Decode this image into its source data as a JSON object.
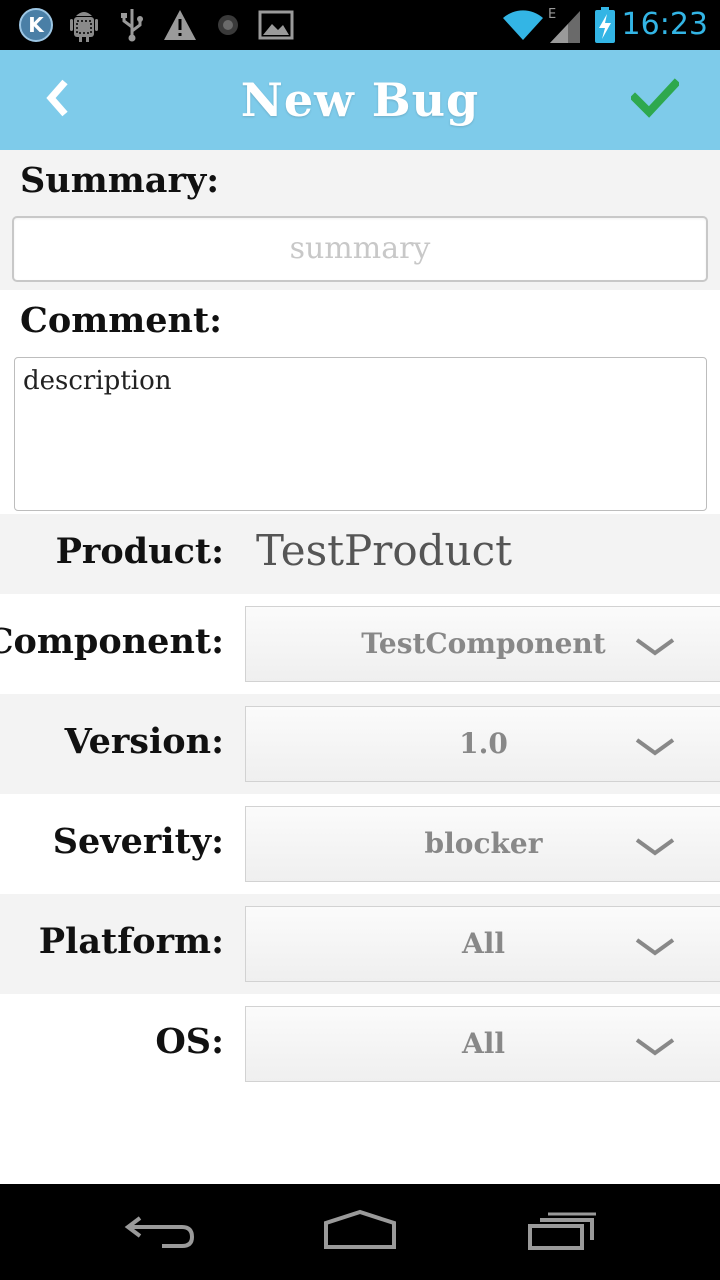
{
  "status_bar": {
    "time": "16:23",
    "icons": [
      "k-app-icon",
      "android-debug-icon",
      "usb-icon",
      "warning-icon",
      "dot-icon",
      "image-icon",
      "wifi-icon",
      "signal-icon",
      "battery-charging-icon"
    ],
    "network_type": "E"
  },
  "action_bar": {
    "title": "New Bug",
    "back_icon": "chevron-left-icon",
    "confirm_icon": "checkmark-icon",
    "background": "#7ecbea",
    "confirm_color": "#2ea84e"
  },
  "form": {
    "summary_label": "Summary:",
    "summary_placeholder": "summary",
    "comment_label": "Comment:",
    "comment_value": "description",
    "product_label": "Product:",
    "product_value": "TestProduct",
    "component_label": "Component:",
    "component_value": "TestComponent",
    "version_label": "Version:",
    "version_value": "1.0",
    "severity_label": "Severity:",
    "severity_value": "blocker",
    "platform_label": "Platform:",
    "platform_value": "All",
    "os_label": "OS:",
    "os_value": "All"
  },
  "nav_bar": {
    "icons": [
      "back-nav-icon",
      "home-nav-icon",
      "recents-nav-icon"
    ]
  }
}
